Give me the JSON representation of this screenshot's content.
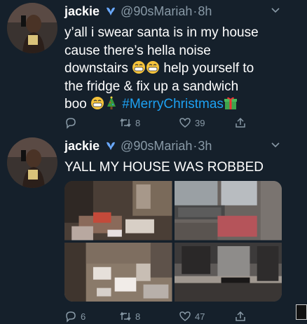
{
  "tweets": [
    {
      "name": "jackie",
      "handle": "@90sMariah",
      "separator": "·",
      "time": "8h",
      "lines": [
        "y’all i swear santa is in my house",
        "cause there’s hella noise"
      ],
      "line3_before": "downstairs",
      "line3_after": " help yourself to",
      "line4": "the fridge & fix up a sandwich",
      "line5_before": "boo",
      "hashtag": "#MerryChristmas",
      "reply_count": "",
      "retweet_count": "8",
      "like_count": "39",
      "emojis": [
        "grimacing-laughing-emoji",
        "grimacing-laughing-emoji",
        "grimacing-laughing-emoji",
        "christmas-tree-emoji",
        "gift-emoji"
      ]
    },
    {
      "name": "jackie",
      "handle": "@90sMariah",
      "separator": "·",
      "time": "3h",
      "text": "YALL MY HOUSE WAS ROBBED",
      "reply_count": "6",
      "retweet_count": "8",
      "like_count": "47"
    }
  ],
  "colors": {
    "background": "#15202b",
    "secondary_text": "#8899a6",
    "hashtag": "#1da1f2"
  },
  "icons": [
    "verified-badge-icon",
    "chevron-down-icon",
    "reply-icon",
    "retweet-icon",
    "like-icon",
    "share-icon"
  ]
}
